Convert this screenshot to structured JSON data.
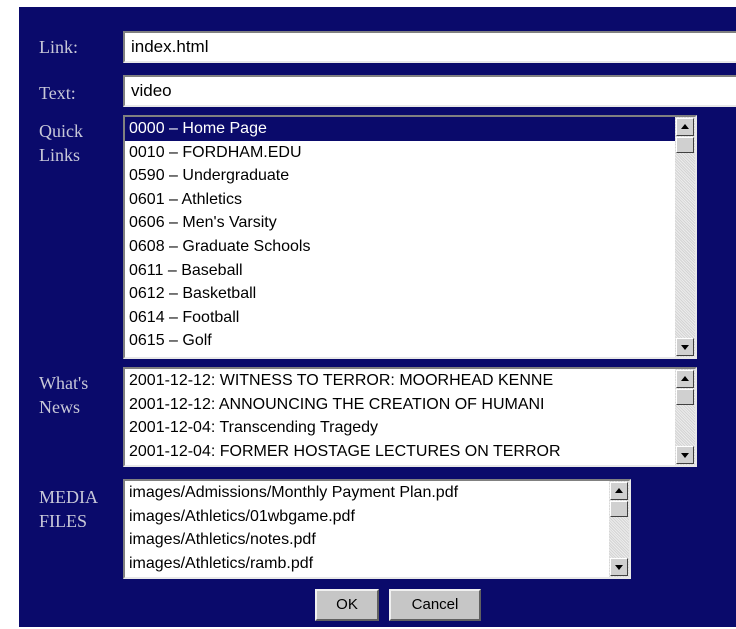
{
  "form": {
    "link_label": "Link:",
    "link_value": "index.html",
    "text_label": "Text:",
    "text_value": "video",
    "quick_links_label": "Quick\nLinks",
    "whats_news_label": "What's\nNews",
    "media_files_label": "MEDIA\nFILES"
  },
  "quick_links": {
    "selected_index": 0,
    "items": [
      "0000 – Home Page",
      "0010 – FORDHAM.EDU",
      "0590 – Undergraduate",
      "0601 – Athletics",
      "0606 – Men's Varsity",
      "0608 – Graduate Schools",
      "0611 – Baseball",
      "0612 – Basketball",
      "0614 – Football",
      "0615 – Golf"
    ]
  },
  "whats_news": {
    "items": [
      "2001-12-12: WITNESS TO TERROR: MOORHEAD KENNE",
      "2001-12-12: ANNOUNCING THE CREATION OF HUMANI",
      "2001-12-04: Transcending Tragedy",
      "2001-12-04: FORMER HOSTAGE LECTURES ON TERROR"
    ]
  },
  "media_files": {
    "items": [
      "images/Admissions/Monthly Payment Plan.pdf",
      "images/Athletics/01wbgame.pdf",
      "images/Athletics/notes.pdf",
      "images/Athletics/ramb.pdf"
    ]
  },
  "buttons": {
    "ok_label": "OK",
    "cancel_label": "Cancel"
  },
  "colors": {
    "panel_background": "#0a0a6b",
    "label_text": "#c8c8d8",
    "selection": "#0a0a6b"
  }
}
